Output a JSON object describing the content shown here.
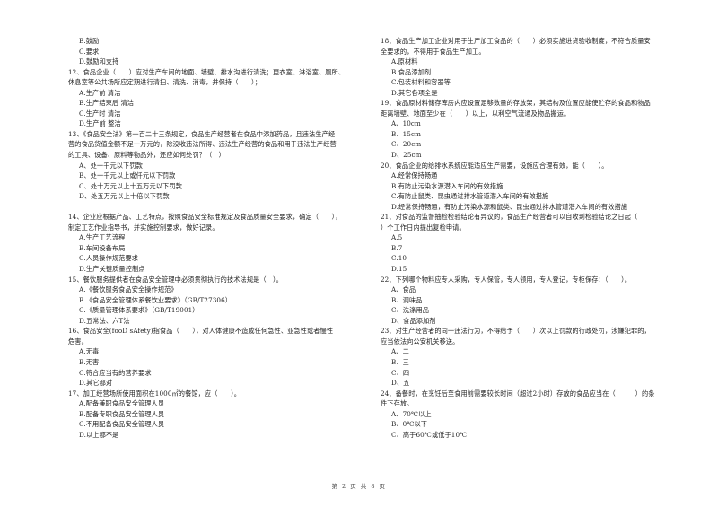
{
  "left_column": [
    {
      "type": "opt",
      "text": "B.鼓励"
    },
    {
      "type": "opt",
      "text": "C.要求"
    },
    {
      "type": "opt",
      "text": "D.鼓励和支持"
    },
    {
      "type": "stem",
      "text": "12、食品企业（　　）应对生产车间的地面、墙壁、排水沟进行清洗；更衣室、淋浴室、厕所、"
    },
    {
      "type": "stem",
      "text": "休息室等公共场所应定期进行清扫、清洗、消毒，并保持（　　）；"
    },
    {
      "type": "opt",
      "text": "A.生产前 清洁"
    },
    {
      "type": "opt",
      "text": "B.生产结束后 清洁"
    },
    {
      "type": "opt",
      "text": "C.生产时 清洁"
    },
    {
      "type": "opt",
      "text": "D.生产前 整洁"
    },
    {
      "type": "stem",
      "text": "13、《食品安全法》第一百二十三条规定，食品生产经营者在食品中添加药品，且违法生产经"
    },
    {
      "type": "stem",
      "text": "营的食品货值金额不足一万元的，除没收违法所得、违法生产经营的食品和用于违法生产经营"
    },
    {
      "type": "stem",
      "text": "的工具、设备、原料等物品外，还应如何处罚？（　）"
    },
    {
      "type": "opt",
      "text": "A、处一千元以下罚款"
    },
    {
      "type": "opt",
      "text": "B、处一千元以上或仟元以下罚款"
    },
    {
      "type": "opt",
      "text": "C、处十万元以上十五万元以下罚款"
    },
    {
      "type": "opt",
      "text": "D、处五万元以上十倍以下罚款"
    },
    {
      "type": "gap",
      "text": ""
    },
    {
      "type": "stem",
      "text": "14、企业应根据产品、工艺特点，按照食品安全标准规定及食品质量安全要求，确定（　　），"
    },
    {
      "type": "stem",
      "text": "制定工艺作业指导书，并实施控制要求，做好记录。"
    },
    {
      "type": "opt",
      "text": "A.生产工艺流程"
    },
    {
      "type": "opt",
      "text": "B.车间设备布局"
    },
    {
      "type": "opt",
      "text": "C.人员操作规范要求"
    },
    {
      "type": "opt",
      "text": "D.生产关键质量控制点"
    },
    {
      "type": "stem",
      "text": "15、餐饮服务提供者在食品安全管理中必须贯彻执行的技术法规是（　）。"
    },
    {
      "type": "opt",
      "text": "A.《餐饮服务食品安全操作规范》"
    },
    {
      "type": "opt",
      "text": "B.《食品安全管理体系餐饮业要求》（GB/T27306）"
    },
    {
      "type": "opt",
      "text": "C.《质量管理体系要求》（GB/T19001）"
    },
    {
      "type": "opt",
      "text": "D.五常法、六T法"
    },
    {
      "type": "stem",
      "text": "16、食品安全(fooD sAfety)指食品（　　），对人体健康不造成任何急性、亚急性或者慢性"
    },
    {
      "type": "stem",
      "text": "危害。"
    },
    {
      "type": "opt",
      "text": "A.无毒"
    },
    {
      "type": "opt",
      "text": "B.无害"
    },
    {
      "type": "opt",
      "text": "C.符合应当有的营养要求"
    },
    {
      "type": "opt",
      "text": "D.其它都对"
    },
    {
      "type": "stem",
      "text": "17、加工经营场所使用面积在1000㎡的餐馆，应（　　）。"
    },
    {
      "type": "opt",
      "text": "A.配备兼职食品安全管理人员"
    },
    {
      "type": "opt",
      "text": "B.配备专职食品安全管理人员"
    },
    {
      "type": "opt",
      "text": "C.不用配备食品安全管理人员"
    },
    {
      "type": "opt",
      "text": "D.以上都不是"
    }
  ],
  "right_column": [
    {
      "type": "stem",
      "text": "18、食品生产加工企业对用于生产加工食品的（　　）必须实施进货验收制度，不符合质量安"
    },
    {
      "type": "stem",
      "text": "全要求的，不得用于食品生产加工。"
    },
    {
      "type": "opt",
      "text": "A.原材料"
    },
    {
      "type": "opt",
      "text": "B.食品添加剂"
    },
    {
      "type": "opt",
      "text": "C.包装材料和容器等"
    },
    {
      "type": "opt",
      "text": "D.其它各项全是"
    },
    {
      "type": "stem",
      "text": "19、食品原材料储存库房内应设置足够数量的存放架，其结构及位置应能使贮存的食品和物品"
    },
    {
      "type": "stem",
      "text": "距离墙壁、地面至少在（　　）以上，以利空气流通及物品搬运。"
    },
    {
      "type": "opt",
      "text": "A、10cm"
    },
    {
      "type": "opt",
      "text": "B、15cm"
    },
    {
      "type": "opt",
      "text": "C、20cm"
    },
    {
      "type": "opt",
      "text": "D、25cm"
    },
    {
      "type": "stem",
      "text": "20、食品企业的给排水系统应能适应生产需要，设施应合理有效，能（　　）。"
    },
    {
      "type": "opt",
      "text": "A.经常保持畅通"
    },
    {
      "type": "opt",
      "text": "B.有防止污染水源潜入车间的有效措施"
    },
    {
      "type": "opt",
      "text": "C.有防止鼠类、昆虫通过排水管道潜入车间的有效措施"
    },
    {
      "type": "opt",
      "text": "D.经常保持畅通，有防止污染水源和鼠类、昆虫通过排水管道潜入车间的有效措施"
    },
    {
      "type": "stem",
      "text": "21、对食品的监督抽检检验结论有异议的，食品生产经营者可以自收到检验结论之日起（"
    },
    {
      "type": "stem",
      "text": "）个工作日内提出复检申请。"
    },
    {
      "type": "opt",
      "text": "A.5"
    },
    {
      "type": "opt",
      "text": "B.7"
    },
    {
      "type": "opt",
      "text": "C.10"
    },
    {
      "type": "opt",
      "text": "D.15"
    },
    {
      "type": "stem",
      "text": "22、下列哪个物料应专人采购，专人保管，专人领用，专人登记，专柜保存：（　　）。"
    },
    {
      "type": "opt",
      "text": "A、食品"
    },
    {
      "type": "opt",
      "text": "B、调味品"
    },
    {
      "type": "opt",
      "text": "C、洗涤用品"
    },
    {
      "type": "opt",
      "text": "D、食品添加剂"
    },
    {
      "type": "stem",
      "text": "23、对生产经营者的同一违法行为，不得给予（　　）次以上罚款的行政处罚，涉嫌犯罪的，"
    },
    {
      "type": "stem",
      "text": "应当依法向公安机关移送。"
    },
    {
      "type": "opt",
      "text": "A、二"
    },
    {
      "type": "opt",
      "text": "B、三"
    },
    {
      "type": "opt",
      "text": "C、四"
    },
    {
      "type": "opt",
      "text": "D、五"
    },
    {
      "type": "stem",
      "text": "24、备餐时，在烹饪后至食用前需要较长时间（超过2小时）存放的食品应当在（　　　）的条"
    },
    {
      "type": "stem",
      "text": "件下存放。"
    },
    {
      "type": "opt",
      "text": "A、70℃以上"
    },
    {
      "type": "opt",
      "text": "B、0℃以下"
    },
    {
      "type": "opt",
      "text": "C、高于60℃或低于10℃"
    }
  ],
  "footer": {
    "page_label": "第 2 页 共 8 页"
  }
}
